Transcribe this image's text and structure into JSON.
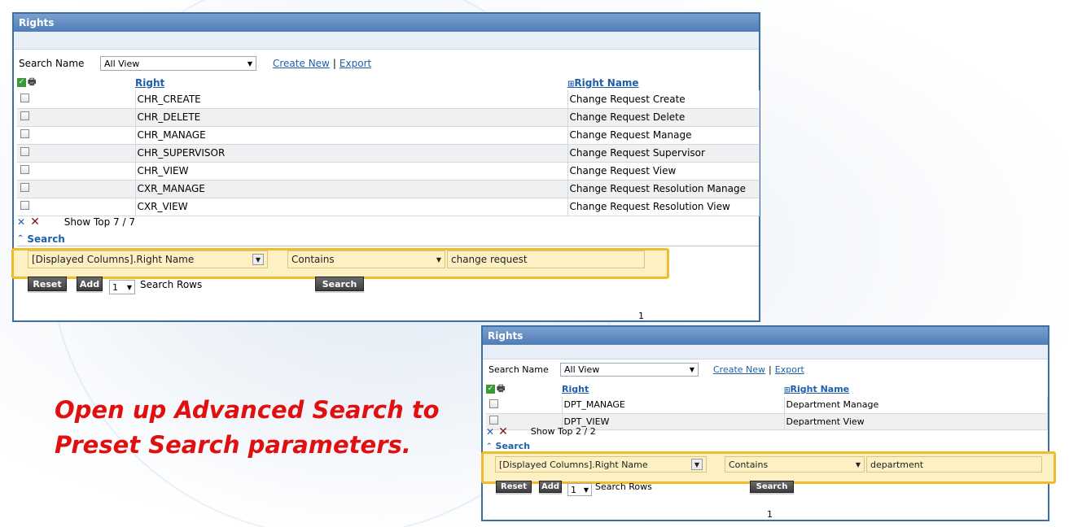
{
  "caption": {
    "line1": "Open up Advanced Search to",
    "line2": "Preset Search parameters."
  },
  "panel1": {
    "title": "Rights",
    "search_name_label": "Search Name",
    "view_value": "All View",
    "create_new": "Create New",
    "separator": "|",
    "export": "Export",
    "col_right": "Right",
    "col_right_name": "Right Name",
    "col_right_name_prefix": "⊞",
    "rows": [
      {
        "right": "CHR_CREATE",
        "name": "Change Request Create"
      },
      {
        "right": "CHR_DELETE",
        "name": "Change Request Delete"
      },
      {
        "right": "CHR_MANAGE",
        "name": "Change Request Manage"
      },
      {
        "right": "CHR_SUPERVISOR",
        "name": "Change Request Supervisor"
      },
      {
        "right": "CHR_VIEW",
        "name": "Change Request View"
      },
      {
        "right": "CXR_MANAGE",
        "name": "Change Request Resolution Manage"
      },
      {
        "right": "CXR_VIEW",
        "name": "Change Request Resolution View"
      }
    ],
    "show_top": "Show Top 7 / 7",
    "search_toggle": "Search",
    "filter_column": "[Displayed Columns].Right Name",
    "filter_op": "Contains",
    "filter_value": "change request",
    "reset": "Reset",
    "add": "Add",
    "rows_count": "1",
    "search_rows": "Search Rows",
    "search_btn": "Search",
    "page": "1"
  },
  "panel2": {
    "title": "Rights",
    "search_name_label": "Search Name",
    "view_value": "All View",
    "create_new": "Create New",
    "separator": "|",
    "export": "Export",
    "col_right": "Right",
    "col_right_name": "Right Name",
    "col_right_name_prefix": "⊞",
    "rows": [
      {
        "right": "DPT_MANAGE",
        "name": "Department Manage"
      },
      {
        "right": "DPT_VIEW",
        "name": "Department View"
      }
    ],
    "show_top": "Show Top 2 / 2",
    "search_toggle": "Search",
    "filter_column": "[Displayed Columns].Right Name",
    "filter_op": "Contains",
    "filter_value": "department",
    "reset": "Reset",
    "add": "Add",
    "rows_count": "1",
    "search_rows": "Search Rows",
    "search_btn": "Search",
    "page": "1"
  },
  "colors": {
    "caption": "#e01010",
    "highlight": "#f0bc2d",
    "header": "#4f7db7",
    "link": "#1f5fa8"
  }
}
